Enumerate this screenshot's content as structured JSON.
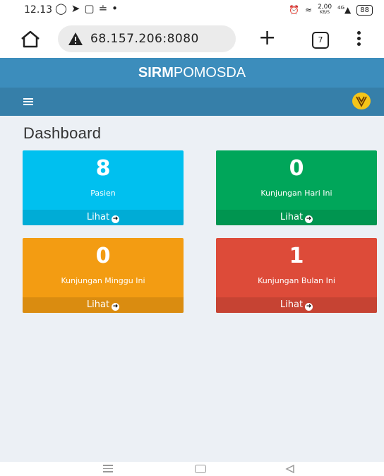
{
  "status_bar": {
    "time": "12.13",
    "left_icons": [
      "whatsapp-icon",
      "telegram-icon",
      "tv-icon",
      "nfc-icon",
      "dot-icon"
    ],
    "right_icons": [
      "alarm-icon",
      "vowifi-icon",
      "data-speed-icon",
      "signal-icon",
      "battery-icon"
    ],
    "speed_value": "2,00",
    "speed_unit": "KB/S",
    "network": "4G",
    "battery": "88"
  },
  "browser": {
    "url": "68.157.206:8080",
    "tab_count": "7",
    "warning_icon": "warning-icon",
    "home_icon": "home-icon",
    "new_tab_icon": "plus-icon",
    "menu_icon": "more-vertical-icon"
  },
  "app": {
    "brand_bold": "SIRM",
    "brand_light": "POMOSDA",
    "brand_color": "#3c8dbc",
    "navbar_color": "#367fa9",
    "menu_icon": "hamburger-icon",
    "user_icon": "logo-icon"
  },
  "page": {
    "title": "Dashboard",
    "background": "#ecf0f5"
  },
  "stat_boxes": [
    {
      "value": "8",
      "label": "Pasien",
      "link": "Lihat",
      "color": "#00c0ef"
    },
    {
      "value": "0",
      "label": "Kunjungan Hari Ini",
      "link": "Lihat",
      "color": "#00a65a"
    },
    {
      "value": "0",
      "label": "Kunjungan Minggu Ini",
      "link": "Lihat",
      "color": "#f39c12"
    },
    {
      "value": "1",
      "label": "Kunjungan Bulan Ini",
      "link": "Lihat",
      "color": "#dd4b39"
    }
  ],
  "system_nav": [
    "recent-apps-icon",
    "home-button-icon",
    "back-icon"
  ]
}
